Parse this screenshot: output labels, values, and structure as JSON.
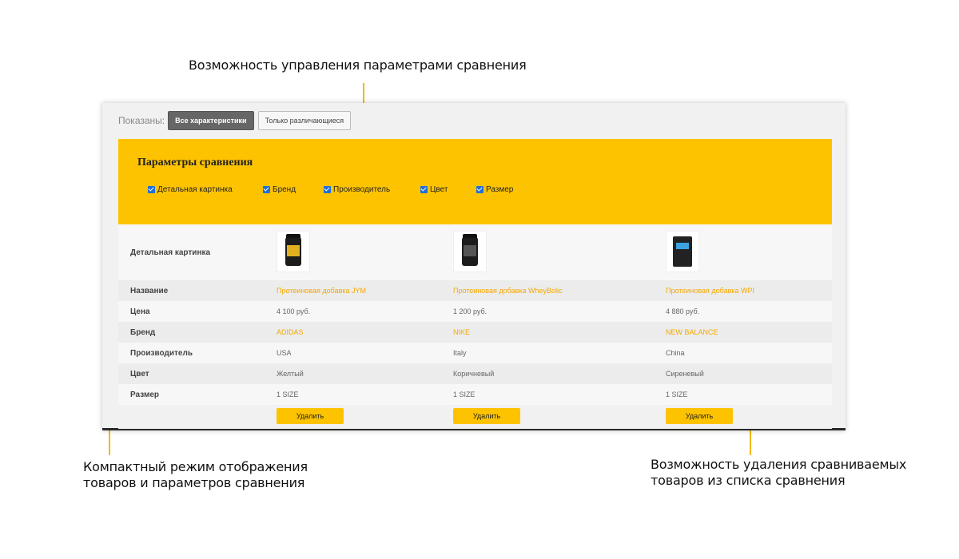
{
  "callouts": {
    "top": "Возможность управления параметрами сравнения",
    "left_line1": "Компактный режим отображения",
    "left_line2": "товаров и параметров сравнения",
    "right_line1": "Возможность удаления сравниваемых",
    "right_line2": "товаров из списка сравнения"
  },
  "filter": {
    "label": "Показаны:",
    "all_button": "Все характеристики",
    "diff_button": "Только различающиеся"
  },
  "params": {
    "title": "Параметры сравнения",
    "options": [
      "Детальная картинка",
      "Бренд",
      "Производитель",
      "Цвет",
      "Размер"
    ]
  },
  "table": {
    "rows": {
      "image": "Детальная картинка",
      "name": "Название",
      "price": "Цена",
      "brand": "Бренд",
      "maker": "Производитель",
      "color": "Цвет",
      "size": "Размер"
    },
    "products": [
      {
        "name": "Протеиновая добавка JYM",
        "price": "4 100 руб.",
        "brand": "ADIDAS",
        "maker": "USA",
        "color": "Желтый",
        "size": "1 SIZE"
      },
      {
        "name": "Протеиновая добавка WheyBolic",
        "price": "1 200 руб.",
        "brand": "NIKE",
        "maker": "Italy",
        "color": "Коричневый",
        "size": "1 SIZE"
      },
      {
        "name": "Протеиновая добавка WPI",
        "price": "4 880 руб.",
        "brand": "NEW BALANCE",
        "maker": "China",
        "color": "Сиреневый",
        "size": "1 SIZE"
      }
    ],
    "delete_label": "Удалить"
  },
  "colors": {
    "accent": "#fdc300",
    "link": "#f5a800"
  }
}
